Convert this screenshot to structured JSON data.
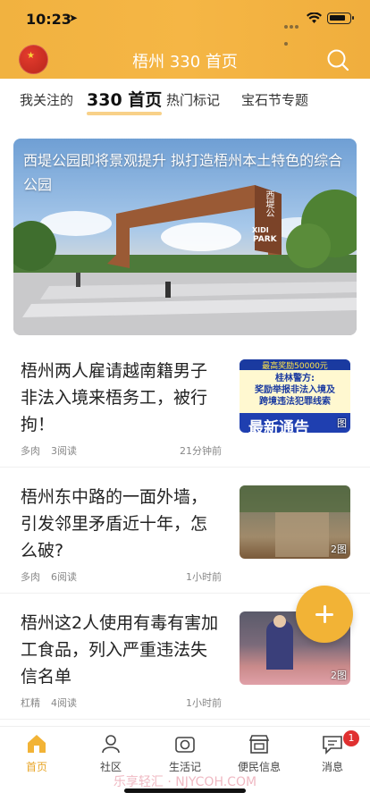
{
  "status": {
    "time": "10:23",
    "location_icon": "location-arrow-icon"
  },
  "header": {
    "title": "梧州 330 首页",
    "search_icon": "search-icon",
    "avatar_star": "★"
  },
  "tabs": [
    {
      "label": "我关注的"
    },
    {
      "label": "330 首页",
      "active": true
    },
    {
      "label": "热门标记"
    },
    {
      "label": "宝石节专题"
    }
  ],
  "banner": {
    "caption": "西堤公园即将景观提升  拟打造梧州本土特色的综合公园",
    "sign_1": "西堤公",
    "sign_2": "XIDI",
    "sign_3": "PARK"
  },
  "feed": [
    {
      "title": "梧州两人雇请越南籍男子非法入境来梧务工，被行拘！",
      "author": "多肉",
      "reads": "3阅读",
      "time": "21分钟前",
      "badge": "图",
      "thumb_text_1": "最高奖励50000元",
      "thumb_text_2": "桂林警方:",
      "thumb_text_3": "奖励举报非法入境及",
      "thumb_text_4": "跨境违法犯罪线索",
      "thumb_text_5": "最新通告"
    },
    {
      "title": "梧州东中路的一面外墙，引发邻里矛盾近十年，怎么破?",
      "author": "多肉",
      "reads": "6阅读",
      "time": "1小时前",
      "badge": "2图"
    },
    {
      "title": "梧州这2人使用有毒有害加工食品，列入严重违法失信名单",
      "author": "杠精",
      "reads": "4阅读",
      "time": "1小时前",
      "badge": "2图"
    }
  ],
  "nav": [
    {
      "label": "首页",
      "icon": "home-icon",
      "active": true
    },
    {
      "label": "社区",
      "icon": "community-icon"
    },
    {
      "label": "生活记",
      "icon": "camera-icon"
    },
    {
      "label": "便民信息",
      "icon": "shop-icon"
    },
    {
      "label": "消息",
      "icon": "message-icon",
      "badge": "1"
    }
  ],
  "watermark": "乐享轻汇 · NJYCOH.COM",
  "colors": {
    "accent": "#f2b336",
    "active_nav": "#e8a628"
  }
}
